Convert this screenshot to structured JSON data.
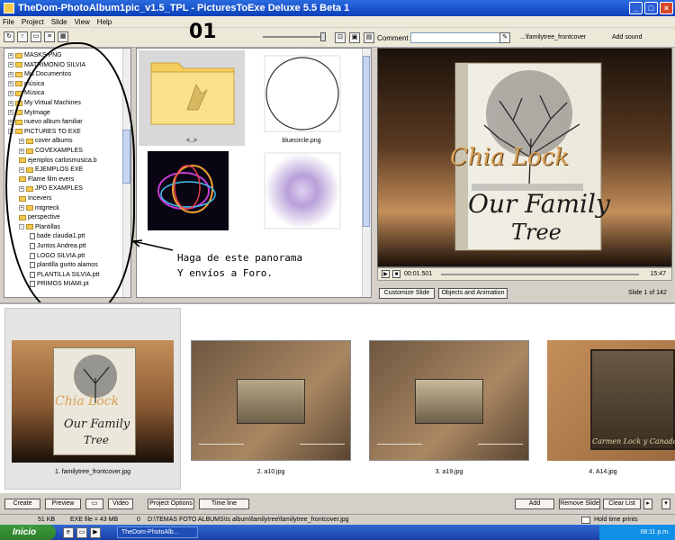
{
  "window": {
    "title": "TheDom-PhotoAlbum1pic_v1.5_TPL - PicturesToExe Deluxe 5.5 Beta 1",
    "minimize": "_",
    "maximize": "□",
    "close": "×"
  },
  "menu": [
    "File",
    "Project",
    "Slide",
    "View",
    "Help"
  ],
  "toolbar": {
    "overlay_label": "01",
    "comment_label": "Comment",
    "comment_value": "",
    "file_label": "...\\familytree_frontcover",
    "add_sound": "Add sound"
  },
  "tree": {
    "items": [
      {
        "label": "MASKS PNG",
        "type": "folder",
        "level": 1,
        "exp": "+"
      },
      {
        "label": "MATRIMONIO SILVIA",
        "type": "folder",
        "level": 1,
        "exp": "+"
      },
      {
        "label": "Mis Documentos",
        "type": "folder",
        "level": 1,
        "exp": "+"
      },
      {
        "label": "música",
        "type": "folder",
        "level": 1,
        "exp": "+"
      },
      {
        "label": "Música",
        "type": "folder",
        "level": 1,
        "exp": "+"
      },
      {
        "label": "My Virtual Machines",
        "type": "folder",
        "level": 1,
        "exp": "+"
      },
      {
        "label": "MyImage",
        "type": "folder",
        "level": 1,
        "exp": "+"
      },
      {
        "label": "nuevo album familiar",
        "type": "folder",
        "level": 1,
        "exp": "+"
      },
      {
        "label": "PICTURES TO EXE",
        "type": "folder",
        "level": 1,
        "exp": "-"
      },
      {
        "label": "cover albums",
        "type": "folder",
        "level": 2,
        "exp": "+"
      },
      {
        "label": "COVEXAMPLES",
        "type": "folder",
        "level": 2,
        "exp": "+"
      },
      {
        "label": "ejemplos carlosmusica.b",
        "type": "folder",
        "level": 2,
        "exp": ""
      },
      {
        "label": "EJEMPLOS EXE",
        "type": "folder",
        "level": 2,
        "exp": "+"
      },
      {
        "label": "Flame film evers",
        "type": "folder",
        "level": 2,
        "exp": ""
      },
      {
        "label": "JPD EXAMPLES",
        "type": "folder",
        "level": 2,
        "exp": "+"
      },
      {
        "label": "Incevers",
        "type": "folder",
        "level": 2,
        "exp": ""
      },
      {
        "label": "mtgrteck",
        "type": "folder",
        "level": 2,
        "exp": "+"
      },
      {
        "label": "perspective",
        "type": "folder",
        "level": 2,
        "exp": ""
      },
      {
        "label": "Plantillas",
        "type": "folder",
        "level": 2,
        "exp": "-"
      },
      {
        "label": "bade claudia1.ptt",
        "type": "file",
        "level": 3,
        "exp": ""
      },
      {
        "label": "Juntos Andrea.ptt",
        "type": "file",
        "level": 3,
        "exp": ""
      },
      {
        "label": "LOGO SILVIA.ptt",
        "type": "file",
        "level": 3,
        "exp": ""
      },
      {
        "label": "plantilla gurito alamos",
        "type": "file",
        "level": 3,
        "exp": ""
      },
      {
        "label": "PLANTILLA SILVIA.ptt",
        "type": "file",
        "level": 3,
        "exp": ""
      },
      {
        "label": "PRIMOS MIAMI.pt",
        "type": "file",
        "level": 3,
        "exp": ""
      }
    ]
  },
  "browser": {
    "items": [
      {
        "caption": "<..>"
      },
      {
        "caption": "bluecircle.png"
      },
      {
        "caption": ""
      },
      {
        "caption": ""
      }
    ]
  },
  "annotation": "Haga de este panorama\nY envíos a Foro.",
  "preview": {
    "title_script": "Chia Lock",
    "title_line1": "Our Family",
    "title_line2": "Tree",
    "time_current": "00:01.501",
    "time_total": "15:47",
    "play": "▶"
  },
  "buttons": {
    "customize_slide": "Customize Slide",
    "objects_animation": "Objects and Animation",
    "slide_of": "Slide 1 of 142",
    "create": "Create",
    "preview": "Preview",
    "video": "Video",
    "project_options": "Project Options",
    "timeline": "Time line",
    "add": "Add",
    "remove_slide": "Remove Slide",
    "clear_list": "Clear List"
  },
  "slides": [
    {
      "caption": "1. familytree_frontcover.jpg",
      "mini_title_line1": "Our Family",
      "mini_title_line2": "Tree",
      "mini_script": "Chia Lock"
    },
    {
      "caption": "2. a10.jpg"
    },
    {
      "caption": "3. a19.jpg"
    },
    {
      "caption": "4. A14.jpg",
      "photo_caption": "Carmen Lock y Canadas"
    }
  ],
  "status": {
    "size": "51 KB",
    "exe_size": "EXE file = 43 MB",
    "position": "0",
    "path": "D:\\TEMAS FOTO ALBUMS\\Is album\\familytree\\familytree_frontcover.jpg",
    "hold_time": "Hold time prints"
  },
  "taskbar": {
    "start": "Inicio",
    "task": "TheDom-PhotoAlb...",
    "clock": "08:11 p.m."
  },
  "colors": {
    "title_bar": "#0a3fb8",
    "preview_brown": "#c48e5a",
    "start_green": "#3c9a3c"
  }
}
